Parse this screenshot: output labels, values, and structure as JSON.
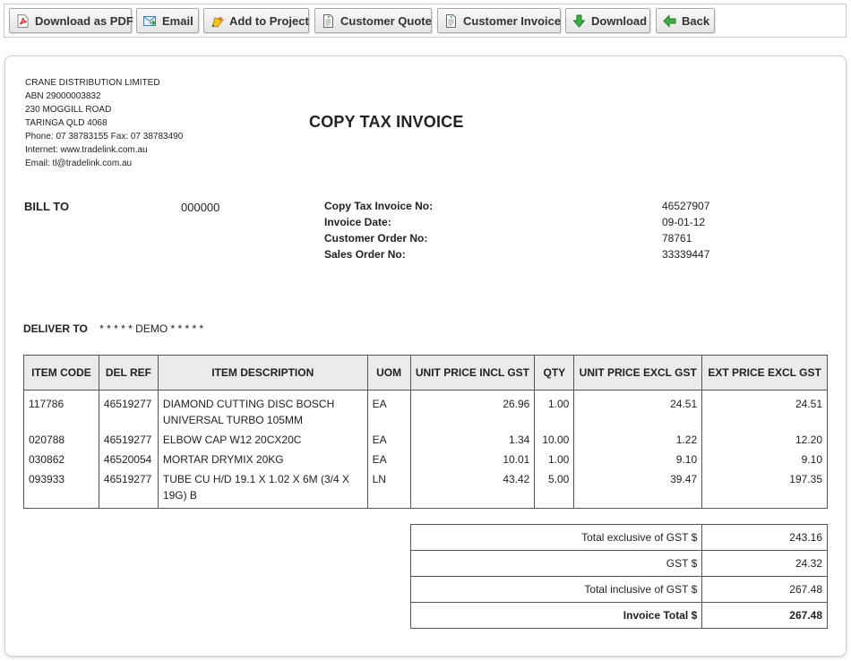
{
  "toolbar": {
    "buttons": [
      {
        "label": "Download as PDF",
        "icon": "pdf-icon"
      },
      {
        "label": "Email",
        "icon": "email-icon"
      },
      {
        "label": "Add to Project",
        "icon": "add-to-project-icon"
      },
      {
        "label": "Customer Quote",
        "icon": "document-icon"
      },
      {
        "label": "Customer Invoice",
        "icon": "document-icon"
      },
      {
        "label": "Download",
        "icon": "green-down-arrow-icon"
      },
      {
        "label": "Back",
        "icon": "green-left-arrow-icon"
      }
    ]
  },
  "company": {
    "name": "CRANE DISTRIBUTION LIMITED",
    "abn": "ABN 29000003832",
    "address1": "230 MOGGILL ROAD",
    "address2": "TARINGA QLD 4068",
    "phone": "Phone: 07 38783155 Fax: 07 38783490",
    "internet": "Internet: www.tradelink.com.au",
    "email": "Email: tl@tradelink.com.au"
  },
  "document_title": "COPY TAX INVOICE",
  "bill_to": {
    "label": "BILL TO",
    "value": "000000"
  },
  "meta": {
    "labels": [
      "Copy Tax Invoice No:",
      "Invoice Date:",
      "Customer Order No:",
      "Sales Order No:"
    ],
    "values": [
      "46527907",
      "09-01-12",
      "78761",
      "33339447"
    ]
  },
  "deliver_to": {
    "label": "DELIVER TO",
    "value": "* * * * * DEMO * * * * *"
  },
  "items_table": {
    "headers": [
      "ITEM CODE",
      "DEL REF",
      "ITEM DESCRIPTION",
      "UOM",
      "UNIT PRICE INCL GST",
      "QTY",
      "UNIT PRICE EXCL GST",
      "EXT PRICE EXCL GST"
    ],
    "rows": [
      [
        "117786",
        "46519277",
        "DIAMOND CUTTING DISC BOSCH UNIVERSAL TURBO 105MM",
        "EA",
        "26.96",
        "1.00",
        "24.51",
        "24.51"
      ],
      [
        "020788",
        "46519277",
        "ELBOW CAP W12 20CX20C",
        "EA",
        "1.34",
        "10.00",
        "1.22",
        "12.20"
      ],
      [
        "030862",
        "46520054",
        "MORTAR DRYMIX 20KG",
        "EA",
        "10.01",
        "1.00",
        "9.10",
        "9.10"
      ],
      [
        "093933",
        "46519277",
        "TUBE CU H/D 19.1 X 1.02 X 6M (3/4 X 19G) B",
        "LN",
        "43.42",
        "5.00",
        "39.47",
        "197.35"
      ]
    ]
  },
  "totals": [
    {
      "label": "Total exclusive of GST $",
      "value": "243.16"
    },
    {
      "label": "GST $",
      "value": "24.32"
    },
    {
      "label": "Total inclusive of GST $",
      "value": "267.48"
    },
    {
      "label": "Invoice Total $",
      "value": "267.48"
    }
  ]
}
